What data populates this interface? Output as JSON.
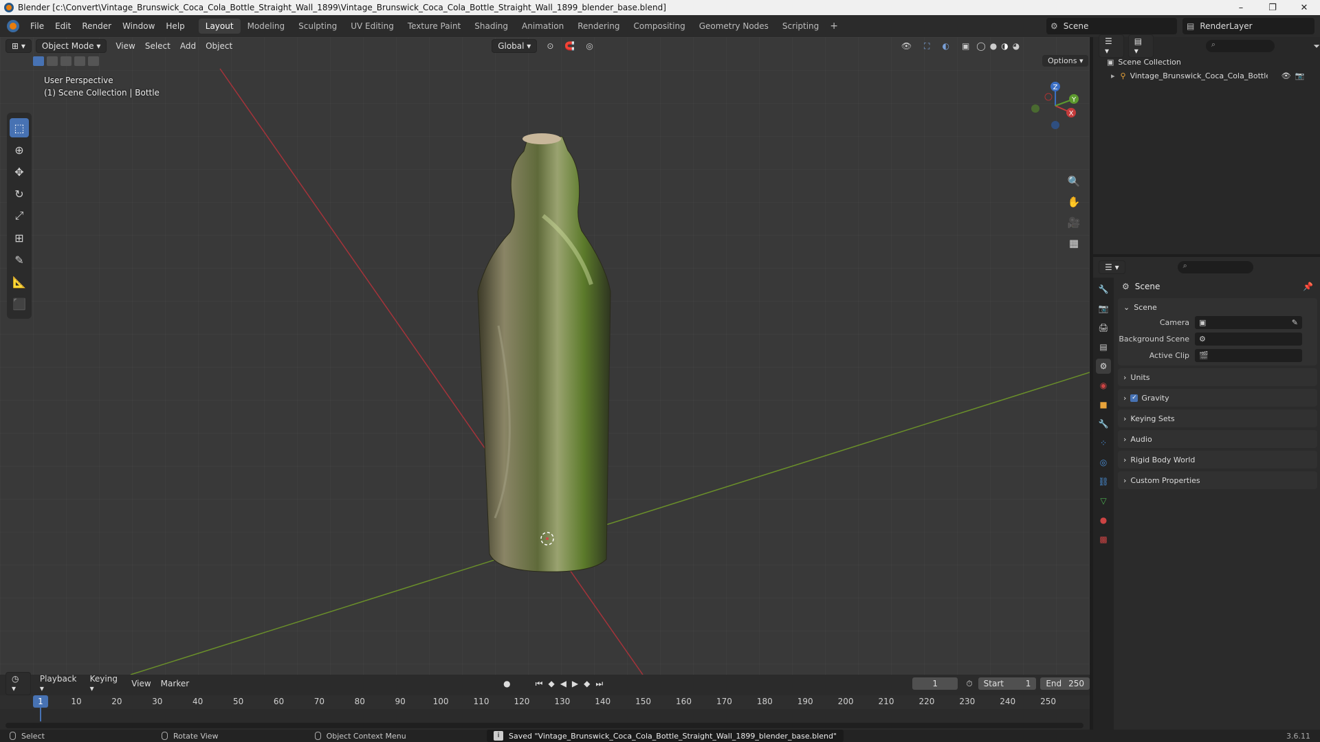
{
  "window": {
    "title": "Blender [c:\\Convert\\Vintage_Brunswick_Coca_Cola_Bottle_Straight_Wall_1899\\Vintage_Brunswick_Coca_Cola_Bottle_Straight_Wall_1899_blender_base.blend]",
    "minimize": "–",
    "maximize": "❐",
    "close": "✕"
  },
  "menu": [
    "File",
    "Edit",
    "Render",
    "Window",
    "Help"
  ],
  "workspaces": [
    "Layout",
    "Modeling",
    "Sculpting",
    "UV Editing",
    "Texture Paint",
    "Shading",
    "Animation",
    "Rendering",
    "Compositing",
    "Geometry Nodes",
    "Scripting"
  ],
  "workspace_add": "+",
  "scene_selector": "Scene",
  "renderlayer_selector": "RenderLayer",
  "viewport": {
    "mode": "Object Mode",
    "menus": [
      "View",
      "Select",
      "Add",
      "Object"
    ],
    "orientation": "Global",
    "options": "Options",
    "overlay_line1": "User Perspective",
    "overlay_line2": "(1) Scene Collection | Bottle",
    "gizmo_x": "X",
    "gizmo_y": "Y",
    "gizmo_z": "Z"
  },
  "outliner": {
    "root": "Scene Collection",
    "item": "Vintage_Brunswick_Coca_Cola_Bottle_S"
  },
  "properties": {
    "header": "Scene",
    "panel_scene": "Scene",
    "camera_label": "Camera",
    "bg_scene_label": "Background Scene",
    "active_clip_label": "Active Clip",
    "panels": [
      "Units",
      "Gravity",
      "Keying Sets",
      "Audio",
      "Rigid Body World",
      "Custom Properties"
    ],
    "gravity_checked": true
  },
  "timeline": {
    "menus": [
      "Playback",
      "Keying",
      "View",
      "Marker"
    ],
    "current_frame": "1",
    "start_label": "Start",
    "start": "1",
    "end_label": "End",
    "end": "250",
    "ticks": [
      "10",
      "20",
      "30",
      "40",
      "50",
      "60",
      "70",
      "80",
      "90",
      "100",
      "110",
      "120",
      "130",
      "140",
      "150",
      "160",
      "170",
      "180",
      "190",
      "200",
      "210",
      "220",
      "230",
      "240",
      "250"
    ]
  },
  "statusbar": {
    "select": "Select",
    "rotate": "Rotate View",
    "context": "Object Context Menu",
    "saved": "Saved \"Vintage_Brunswick_Coca_Cola_Bottle_Straight_Wall_1899_blender_base.blend\"",
    "version": "3.6.11"
  }
}
